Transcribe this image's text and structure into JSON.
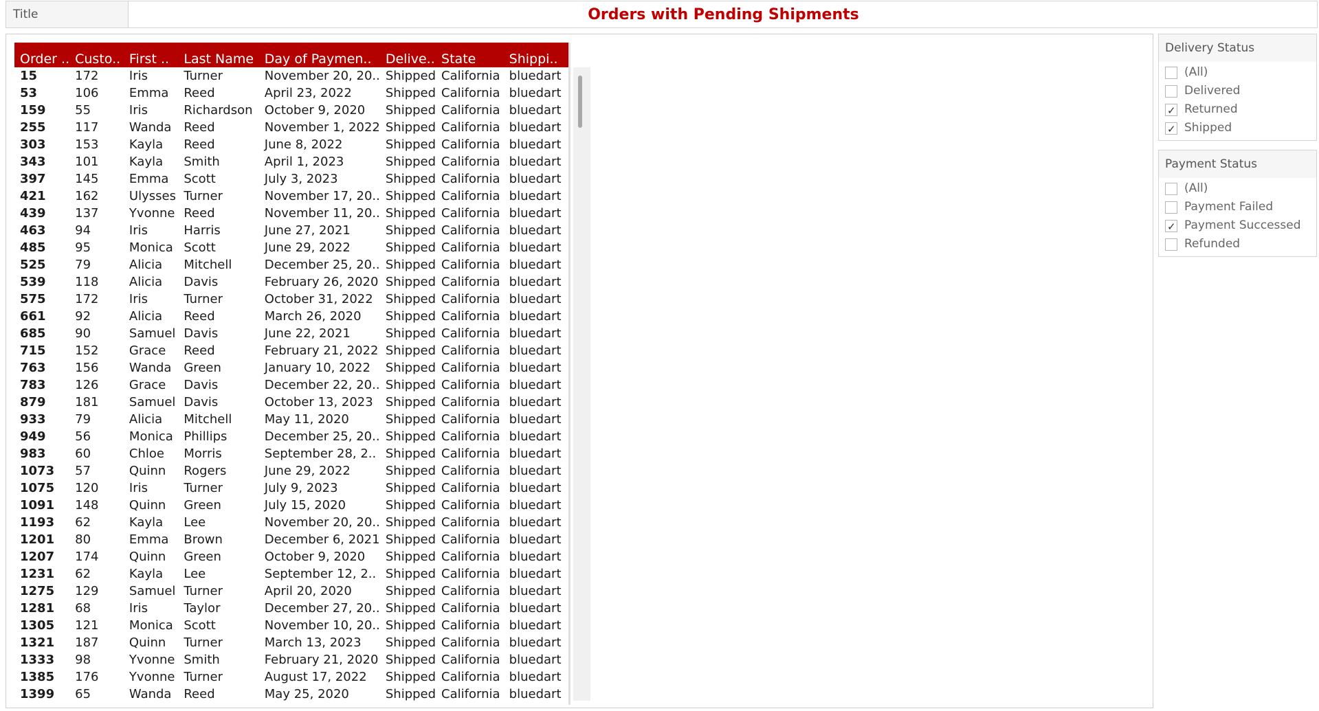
{
  "title": {
    "caption": "Title",
    "text": "Orders with Pending Shipments",
    "color": "#c00000"
  },
  "table": {
    "header_color": "#b30000",
    "columns": [
      "Order ..",
      "Custo..",
      "First ..",
      "Last Name",
      "Day of Paymen..",
      "Delive..",
      "State",
      "Shippi.."
    ],
    "rows": [
      [
        "15",
        "172",
        "Iris",
        "Turner",
        "November 20, 20..",
        "Shipped",
        "California",
        "bluedart"
      ],
      [
        "53",
        "106",
        "Emma",
        "Reed",
        "April 23, 2022",
        "Shipped",
        "California",
        "bluedart"
      ],
      [
        "159",
        "55",
        "Iris",
        "Richardson",
        "October 9, 2020",
        "Shipped",
        "California",
        "bluedart"
      ],
      [
        "255",
        "117",
        "Wanda",
        "Reed",
        "November 1, 2022",
        "Shipped",
        "California",
        "bluedart"
      ],
      [
        "303",
        "153",
        "Kayla",
        "Reed",
        "June 8, 2022",
        "Shipped",
        "California",
        "bluedart"
      ],
      [
        "343",
        "101",
        "Kayla",
        "Smith",
        "April 1, 2023",
        "Shipped",
        "California",
        "bluedart"
      ],
      [
        "397",
        "145",
        "Emma",
        "Scott",
        "July 3, 2023",
        "Shipped",
        "California",
        "bluedart"
      ],
      [
        "421",
        "162",
        "Ulysses",
        "Turner",
        "November 17, 20..",
        "Shipped",
        "California",
        "bluedart"
      ],
      [
        "439",
        "137",
        "Yvonne",
        "Reed",
        "November 11, 20..",
        "Shipped",
        "California",
        "bluedart"
      ],
      [
        "463",
        "94",
        "Iris",
        "Harris",
        "June 27, 2021",
        "Shipped",
        "California",
        "bluedart"
      ],
      [
        "485",
        "95",
        "Monica",
        "Scott",
        "June 29, 2022",
        "Shipped",
        "California",
        "bluedart"
      ],
      [
        "525",
        "79",
        "Alicia",
        "Mitchell",
        "December 25, 20..",
        "Shipped",
        "California",
        "bluedart"
      ],
      [
        "539",
        "118",
        "Alicia",
        "Davis",
        "February 26, 2020",
        "Shipped",
        "California",
        "bluedart"
      ],
      [
        "575",
        "172",
        "Iris",
        "Turner",
        "October 31, 2022",
        "Shipped",
        "California",
        "bluedart"
      ],
      [
        "661",
        "92",
        "Alicia",
        "Reed",
        "March 26, 2020",
        "Shipped",
        "California",
        "bluedart"
      ],
      [
        "685",
        "90",
        "Samuel",
        "Davis",
        "June 22, 2021",
        "Shipped",
        "California",
        "bluedart"
      ],
      [
        "715",
        "152",
        "Grace",
        "Reed",
        "February 21, 2022",
        "Shipped",
        "California",
        "bluedart"
      ],
      [
        "763",
        "156",
        "Wanda",
        "Green",
        "January 10, 2022",
        "Shipped",
        "California",
        "bluedart"
      ],
      [
        "783",
        "126",
        "Grace",
        "Davis",
        "December 22, 20..",
        "Shipped",
        "California",
        "bluedart"
      ],
      [
        "879",
        "181",
        "Samuel",
        "Davis",
        "October 13, 2023",
        "Shipped",
        "California",
        "bluedart"
      ],
      [
        "933",
        "79",
        "Alicia",
        "Mitchell",
        "May 11, 2020",
        "Shipped",
        "California",
        "bluedart"
      ],
      [
        "949",
        "56",
        "Monica",
        "Phillips",
        "December 25, 20..",
        "Shipped",
        "California",
        "bluedart"
      ],
      [
        "983",
        "60",
        "Chloe",
        "Morris",
        "September 28, 2..",
        "Shipped",
        "California",
        "bluedart"
      ],
      [
        "1073",
        "57",
        "Quinn",
        "Rogers",
        "June 29, 2022",
        "Shipped",
        "California",
        "bluedart"
      ],
      [
        "1075",
        "120",
        "Iris",
        "Turner",
        "July 9, 2023",
        "Shipped",
        "California",
        "bluedart"
      ],
      [
        "1091",
        "148",
        "Quinn",
        "Green",
        "July 15, 2020",
        "Shipped",
        "California",
        "bluedart"
      ],
      [
        "1193",
        "62",
        "Kayla",
        "Lee",
        "November 20, 20..",
        "Shipped",
        "California",
        "bluedart"
      ],
      [
        "1201",
        "80",
        "Emma",
        "Brown",
        "December 6, 2021",
        "Shipped",
        "California",
        "bluedart"
      ],
      [
        "1207",
        "174",
        "Quinn",
        "Green",
        "October 9, 2020",
        "Shipped",
        "California",
        "bluedart"
      ],
      [
        "1231",
        "62",
        "Kayla",
        "Lee",
        "September 12, 2..",
        "Shipped",
        "California",
        "bluedart"
      ],
      [
        "1275",
        "129",
        "Samuel",
        "Turner",
        "April 20, 2020",
        "Shipped",
        "California",
        "bluedart"
      ],
      [
        "1281",
        "68",
        "Iris",
        "Taylor",
        "December 27, 20..",
        "Shipped",
        "California",
        "bluedart"
      ],
      [
        "1305",
        "121",
        "Monica",
        "Scott",
        "November 10, 20..",
        "Shipped",
        "California",
        "bluedart"
      ],
      [
        "1321",
        "187",
        "Quinn",
        "Turner",
        "March 13, 2023",
        "Shipped",
        "California",
        "bluedart"
      ],
      [
        "1333",
        "98",
        "Yvonne",
        "Smith",
        "February 21, 2020",
        "Shipped",
        "California",
        "bluedart"
      ],
      [
        "1385",
        "176",
        "Yvonne",
        "Turner",
        "August 17, 2022",
        "Shipped",
        "California",
        "bluedart"
      ],
      [
        "1399",
        "65",
        "Wanda",
        "Reed",
        "May 25, 2020",
        "Shipped",
        "California",
        "bluedart"
      ]
    ]
  },
  "filters": {
    "delivery": {
      "title": "Delivery Status",
      "options": [
        {
          "label": "(All)",
          "checked": false
        },
        {
          "label": "Delivered",
          "checked": false
        },
        {
          "label": "Returned",
          "checked": true
        },
        {
          "label": "Shipped",
          "checked": true
        }
      ]
    },
    "payment": {
      "title": "Payment Status",
      "options": [
        {
          "label": "(All)",
          "checked": false
        },
        {
          "label": "Payment Failed",
          "checked": false
        },
        {
          "label": "Payment Successed",
          "checked": true
        },
        {
          "label": "Refunded",
          "checked": false
        }
      ]
    }
  }
}
